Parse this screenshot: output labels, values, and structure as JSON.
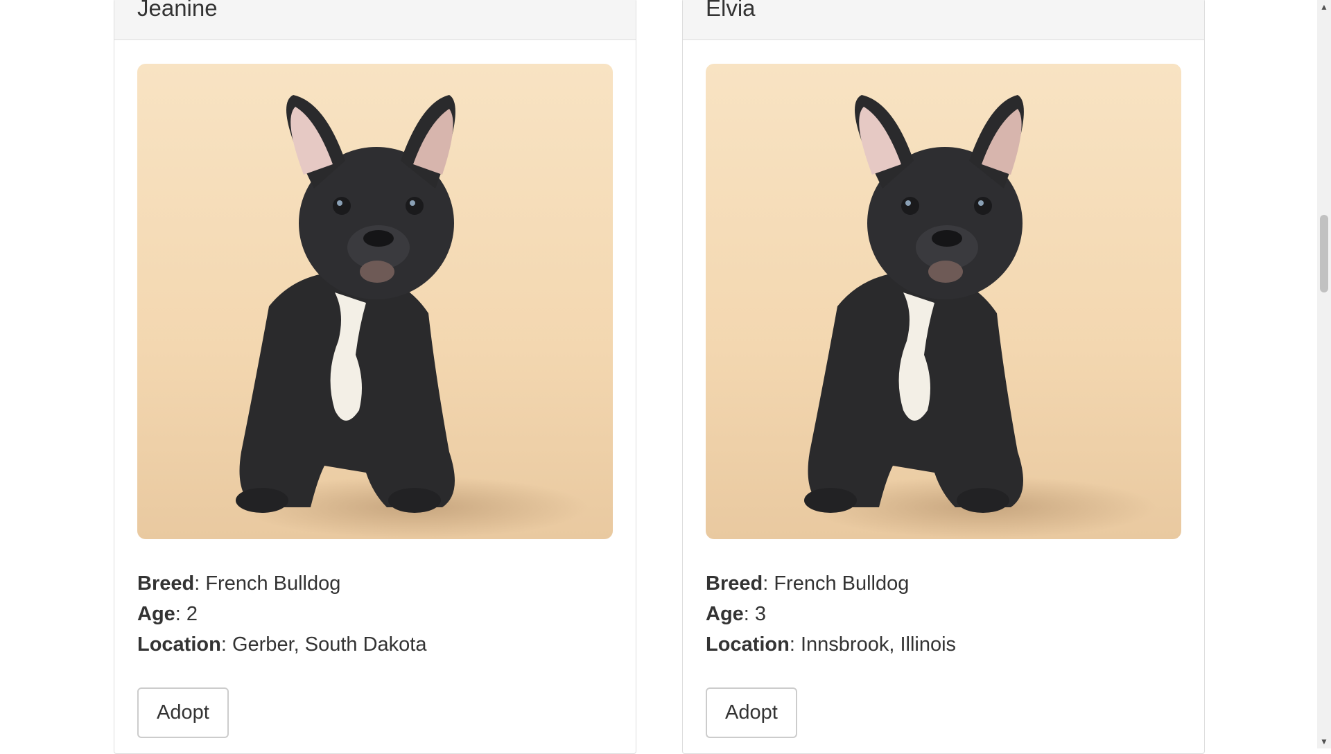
{
  "dogs": [
    {
      "name": "Jeanine",
      "breed_label": "Breed",
      "breed": "French Bulldog",
      "age_label": "Age",
      "age": "2",
      "location_label": "Location",
      "location": "Gerber, South Dakota",
      "adopt_label": "Adopt"
    },
    {
      "name": "Elvia",
      "breed_label": "Breed",
      "breed": "French Bulldog",
      "age_label": "Age",
      "age": "3",
      "location_label": "Location",
      "location": "Innsbrook, Illinois",
      "adopt_label": "Adopt"
    }
  ],
  "separator": ": ",
  "colors": {
    "header_bg": "#f5f5f5",
    "border": "#dddddd",
    "text": "#333333",
    "photo_bg": "#f7dfbd"
  },
  "icons": {
    "scroll_up": "scroll-up-arrow-icon",
    "scroll_down": "scroll-down-arrow-icon"
  }
}
